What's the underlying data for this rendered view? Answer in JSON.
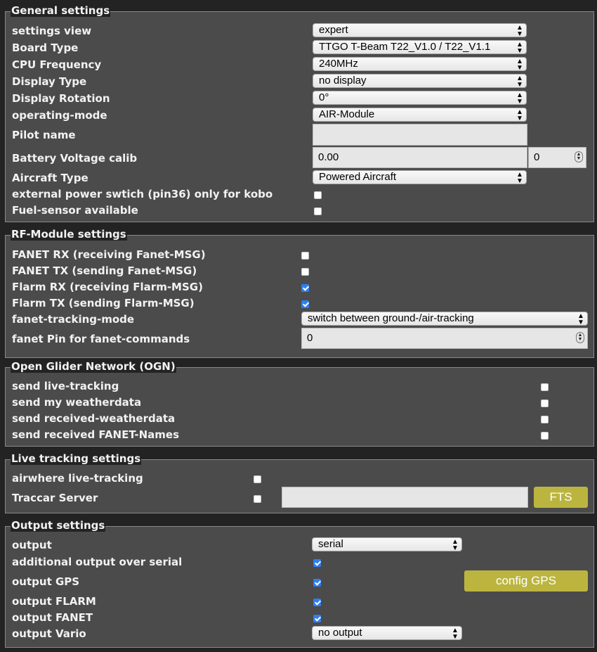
{
  "general": {
    "legend": "General settings",
    "settings_view": {
      "label": "settings view",
      "value": "expert"
    },
    "board_type": {
      "label": "Board Type",
      "value": "TTGO T-Beam T22_V1.0 / T22_V1.1"
    },
    "cpu_frequency": {
      "label": "CPU Frequency",
      "value": "240MHz"
    },
    "display_type": {
      "label": "Display Type",
      "value": "no display"
    },
    "display_rotation": {
      "label": "Display Rotation",
      "value": "0°"
    },
    "operating_mode": {
      "label": "operating-mode",
      "value": "AIR-Module"
    },
    "pilot_name": {
      "label": "Pilot name",
      "value": ""
    },
    "battery_voltage_calib": {
      "label": "Battery Voltage calib",
      "value": "0.00",
      "second_value": "0"
    },
    "aircraft_type": {
      "label": "Aircraft Type",
      "value": "Powered Aircraft"
    },
    "external_power_switch": {
      "label": "external power swtich (pin36) only for kobo",
      "checked": false
    },
    "fuel_sensor": {
      "label": "Fuel-sensor available",
      "checked": false
    }
  },
  "rf_module": {
    "legend": "RF-Module settings",
    "fanet_rx": {
      "label": "FANET RX (receiving Fanet-MSG)",
      "checked": false
    },
    "fanet_tx": {
      "label": "FANET TX (sending Fanet-MSG)",
      "checked": false
    },
    "flarm_rx": {
      "label": "Flarm RX (receiving Flarm-MSG)",
      "checked": true
    },
    "flarm_tx": {
      "label": "Flarm TX (sending Flarm-MSG)",
      "checked": true
    },
    "fanet_tracking_mode": {
      "label": "fanet-tracking-mode",
      "value": "switch between ground-/air-tracking"
    },
    "fanet_pin": {
      "label": "fanet Pin for fanet-commands",
      "value": "0"
    }
  },
  "ogn": {
    "legend": "Open Glider Network (OGN)",
    "send_live_tracking": {
      "label": "send live-tracking",
      "checked": false
    },
    "send_weatherdata": {
      "label": "send my weatherdata",
      "checked": false
    },
    "send_received_weatherdata": {
      "label": "send received-weatherdata",
      "checked": false
    },
    "send_fanet_names": {
      "label": "send received FANET-Names",
      "checked": false
    }
  },
  "live_tracking": {
    "legend": "Live tracking settings",
    "airwhere": {
      "label": "airwhere live-tracking",
      "checked": false
    },
    "traccar": {
      "label": "Traccar Server",
      "checked": false,
      "server": ""
    },
    "fts_button": "FTS"
  },
  "output": {
    "legend": "Output settings",
    "output": {
      "label": "output",
      "value": "serial"
    },
    "additional_serial": {
      "label": "additional output over serial",
      "checked": true
    },
    "output_gps": {
      "label": "output GPS",
      "checked": true
    },
    "config_gps_button": "config GPS",
    "output_flarm": {
      "label": "output FLARM",
      "checked": true
    },
    "output_fanet": {
      "label": "output FANET",
      "checked": true
    },
    "output_vario": {
      "label": "output Vario",
      "value": "no output"
    }
  }
}
